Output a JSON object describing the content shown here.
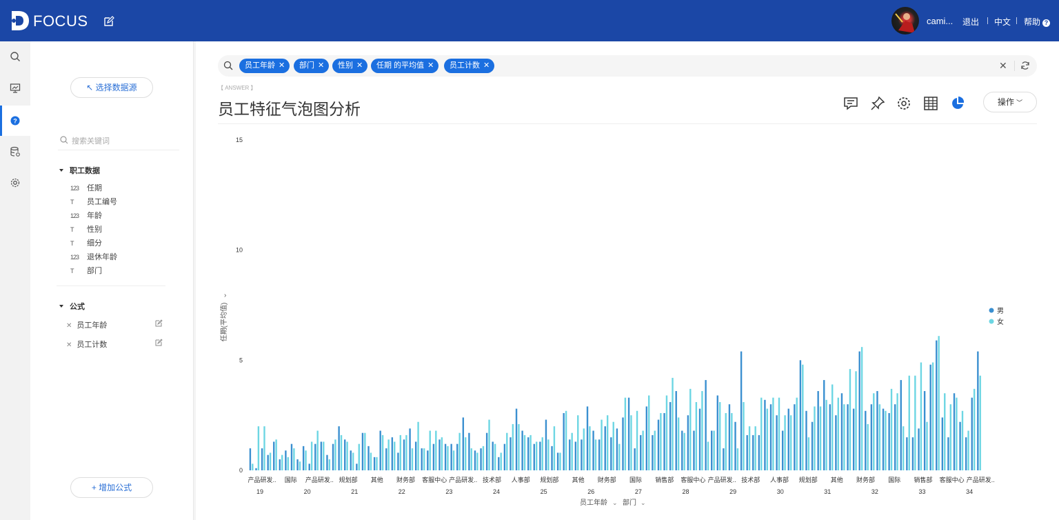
{
  "app": {
    "name": "FOCUS"
  },
  "header": {
    "user": "cami...",
    "logout": "退出",
    "language": "中文",
    "help": "帮助"
  },
  "sidebar": {
    "select_source": "↖ 选择数据源",
    "search_placeholder": "搜索关键词",
    "group_title": "职工数据",
    "fields": [
      {
        "type": "123",
        "label": "任期"
      },
      {
        "type": "T",
        "label": "员工编号"
      },
      {
        "type": "123",
        "label": "年龄"
      },
      {
        "type": "T",
        "label": "性别"
      },
      {
        "type": "T",
        "label": "细分"
      },
      {
        "type": "123",
        "label": "退休年龄"
      },
      {
        "type": "T",
        "label": "部门"
      }
    ],
    "formula_title": "公式",
    "formulas": [
      {
        "label": "员工年龄"
      },
      {
        "label": "员工计数"
      }
    ],
    "add_formula": "+ 增加公式"
  },
  "query": {
    "tags": [
      {
        "label": "员工年龄"
      },
      {
        "label": "部门"
      },
      {
        "label": "性别"
      },
      {
        "label": "任期  的平均值"
      },
      {
        "label": "员工计数"
      }
    ]
  },
  "answer": {
    "label": "【 ANSWER 】",
    "title": "员工特征气泡图分析",
    "operate": "操作"
  },
  "colors": {
    "topbar": "#1b47a6",
    "accent": "#1b6fe0",
    "male": "#3a8fd0",
    "female": "#6dd6e3"
  },
  "chart_data": {
    "type": "bar",
    "ylabel": "任期(平均值)",
    "ylim": [
      0,
      15
    ],
    "yticks": [
      0,
      5,
      10,
      15
    ],
    "xlabels": [
      "员工年龄",
      "部门"
    ],
    "legend": {
      "position": "right",
      "series": [
        "男",
        "女"
      ]
    },
    "ages": [
      "19",
      "20",
      "21",
      "22",
      "23",
      "24",
      "25",
      "26",
      "27",
      "28",
      "29",
      "30",
      "31",
      "32",
      "33",
      "34"
    ],
    "department_labels": [
      "产品研发..",
      "国际",
      "产品研发..",
      "规划部",
      "其他",
      "财务部",
      "客服中心",
      "产品研发..",
      "技术部",
      "人事部",
      "规划部",
      "其他",
      "财务部",
      "国际",
      "销售部",
      "客服中心",
      "产品研发..",
      "技术部",
      "人事部",
      "规划部",
      "其他",
      "财务部",
      "国际",
      "销售部",
      "客服中心",
      "产品研发.."
    ],
    "series": [
      {
        "name": "男",
        "values": [
          1.0,
          0.1,
          1.0,
          0.7,
          1.3,
          0.5,
          0.9,
          1.2,
          0.5,
          1.1,
          0.3,
          1.2,
          1.3,
          0.7,
          1.2,
          2.0,
          1.4,
          0.9,
          0.3,
          1.7,
          1.1,
          0.6,
          1.8,
          1.0,
          1.5,
          0.8,
          1.4,
          1.9,
          1.3,
          1.0,
          0.9,
          1.2,
          1.4,
          1.2,
          1.2,
          1.2,
          2.4,
          1.7,
          0.9,
          1.0,
          1.7,
          1.3,
          0.6,
          1.2,
          1.5,
          2.8,
          1.8,
          1.5,
          1.2,
          1.3,
          2.3,
          1.1,
          0.8,
          2.6,
          1.4,
          1.3,
          1.4,
          2.9,
          1.8,
          1.4,
          2.0,
          1.5,
          1.9,
          2.4,
          3.3,
          1.0,
          1.6,
          2.9,
          1.6,
          2.3,
          2.6,
          3.1,
          3.6,
          1.8,
          2.5,
          1.8,
          2.8,
          4.1,
          1.8,
          3.4,
          1.0,
          3.0,
          2.2,
          5.4,
          1.6,
          1.6,
          1.6,
          3.2,
          3.0,
          2.5,
          1.8,
          2.8,
          3.0,
          5.0,
          2.7,
          2.2,
          3.6,
          4.1,
          3.0,
          2.5,
          3.5,
          3.0,
          2.8,
          5.4,
          2.7,
          3.0,
          3.6,
          2.8,
          2.6,
          3.0,
          4.1,
          1.5,
          1.5,
          1.9,
          3.6,
          4.8,
          5.9,
          2.4,
          1.5,
          3.5,
          2.2,
          1.5,
          3.3,
          5.4
        ]
      },
      {
        "name": "女",
        "values": [
          0.3,
          2.0,
          2.0,
          0.8,
          1.4,
          0.7,
          0.6,
          1.0,
          0.4,
          0.9,
          1.3,
          1.8,
          1.3,
          0.5,
          1.4,
          1.6,
          1.3,
          0.8,
          1.2,
          1.7,
          0.8,
          0.6,
          1.6,
          1.4,
          1.3,
          1.6,
          1.6,
          1.0,
          2.2,
          1.0,
          1.8,
          1.8,
          1.5,
          1.1,
          0.9,
          1.7,
          1.5,
          1.0,
          0.8,
          1.1,
          2.3,
          1.2,
          0.8,
          1.7,
          2.1,
          2.1,
          1.6,
          1.6,
          1.3,
          1.5,
          1.4,
          2.0,
          0.8,
          2.7,
          1.7,
          2.5,
          1.9,
          2.0,
          1.4,
          2.3,
          2.5,
          2.2,
          1.2,
          3.3,
          2.5,
          2.7,
          1.8,
          3.4,
          1.8,
          2.6,
          3.4,
          4.2,
          2.4,
          1.7,
          3.7,
          3.1,
          3.6,
          1.3,
          1.8,
          3.1,
          2.6,
          2.6,
          1.0,
          3.1,
          2.0,
          2.0,
          3.3,
          2.8,
          3.3,
          3.3,
          2.5,
          2.5,
          3.3,
          4.8,
          1.5,
          2.9,
          2.9,
          3.2,
          3.9,
          3.3,
          3.0,
          4.6,
          4.5,
          5.6,
          2.1,
          3.5,
          3.0,
          2.7,
          3.7,
          3.5,
          2.0,
          4.3,
          4.3,
          4.9,
          2.2,
          4.9,
          6.1,
          3.5,
          3.0,
          3.3,
          2.7,
          1.8,
          3.7,
          4.3
        ]
      }
    ]
  }
}
